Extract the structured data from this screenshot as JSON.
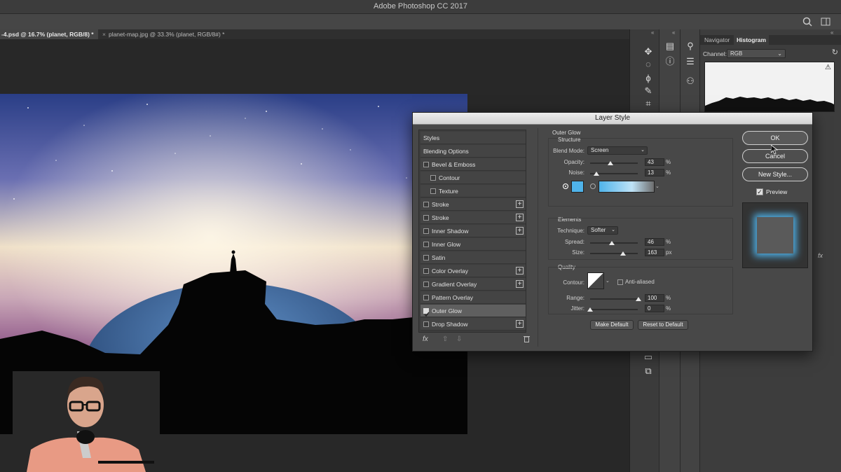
{
  "app": {
    "title": "Adobe Photoshop CC 2017"
  },
  "tabs": [
    {
      "label": "-4.psd @ 16.7% (planet, RGB/8) *",
      "close": "×"
    },
    {
      "label": "planet-map.jpg @ 33.3% (planet, RGB/8#) *",
      "close": "×"
    }
  ],
  "panels": {
    "tabs": [
      "Navigator",
      "Histogram"
    ],
    "collapse": "«",
    "channel_label": "Channel:",
    "channel_value": "RGB",
    "warning": "⚠",
    "side_label": "fx"
  },
  "dialog": {
    "title": "Layer Style",
    "styles_list": [
      {
        "label": "Styles",
        "checkbox": false,
        "plus": false,
        "indent": 0,
        "selected": false
      },
      {
        "label": "Blending Options",
        "checkbox": false,
        "plus": false,
        "indent": 0,
        "selected": false
      },
      {
        "label": "Bevel & Emboss",
        "checkbox": true,
        "plus": false,
        "indent": 0,
        "selected": false
      },
      {
        "label": "Contour",
        "checkbox": true,
        "plus": false,
        "indent": 1,
        "selected": false
      },
      {
        "label": "Texture",
        "checkbox": true,
        "plus": false,
        "indent": 1,
        "selected": false
      },
      {
        "label": "Stroke",
        "checkbox": true,
        "plus": true,
        "indent": 0,
        "selected": false
      },
      {
        "label": "Stroke",
        "checkbox": true,
        "plus": true,
        "indent": 0,
        "selected": false
      },
      {
        "label": "Inner Shadow",
        "checkbox": true,
        "plus": true,
        "indent": 0,
        "selected": false
      },
      {
        "label": "Inner Glow",
        "checkbox": true,
        "plus": false,
        "indent": 0,
        "selected": false
      },
      {
        "label": "Satin",
        "checkbox": true,
        "plus": false,
        "indent": 0,
        "selected": false
      },
      {
        "label": "Color Overlay",
        "checkbox": true,
        "plus": true,
        "indent": 0,
        "selected": false
      },
      {
        "label": "Gradient Overlay",
        "checkbox": true,
        "plus": true,
        "indent": 0,
        "selected": false
      },
      {
        "label": "Pattern Overlay",
        "checkbox": true,
        "plus": false,
        "indent": 0,
        "selected": false
      },
      {
        "label": "Outer Glow",
        "checkbox": true,
        "plus": false,
        "indent": 0,
        "selected": true,
        "checked": true
      },
      {
        "label": "Drop Shadow",
        "checkbox": true,
        "plus": true,
        "indent": 0,
        "selected": false
      }
    ],
    "footer": {
      "fx": "fx",
      "up": "⇧",
      "down": "⇩",
      "trash": "🗑"
    },
    "outer_glow": {
      "section_title": "Outer Glow",
      "structure_title": "Structure",
      "blend_mode_label": "Blend Mode:",
      "blend_mode_value": "Screen",
      "opacity_label": "Opacity:",
      "opacity_value": "43",
      "opacity_unit": "%",
      "noise_label": "Noise:",
      "noise_value": "13",
      "noise_unit": "%",
      "glow_color": "#4fb3ea",
      "elements_title": "Elements",
      "technique_label": "Technique:",
      "technique_value": "Softer",
      "spread_label": "Spread:",
      "spread_value": "46",
      "spread_unit": "%",
      "size_label": "Size:",
      "size_value": "163",
      "size_unit": "px",
      "quality_title": "Quality",
      "contour_label": "Contour:",
      "anti_aliased_label": "Anti-aliased",
      "range_label": "Range:",
      "range_value": "100",
      "range_unit": "%",
      "jitter_label": "Jitter:",
      "jitter_value": "0",
      "jitter_unit": "%",
      "make_default": "Make Default",
      "reset_default": "Reset to Default"
    },
    "buttons": {
      "ok": "OK",
      "cancel": "Cancel",
      "new_style": "New Style..."
    },
    "preview_label": "Preview",
    "preview_checked": "✓"
  },
  "colors": {
    "accent": "#4fb3ea",
    "dialog_bg": "#484848"
  }
}
